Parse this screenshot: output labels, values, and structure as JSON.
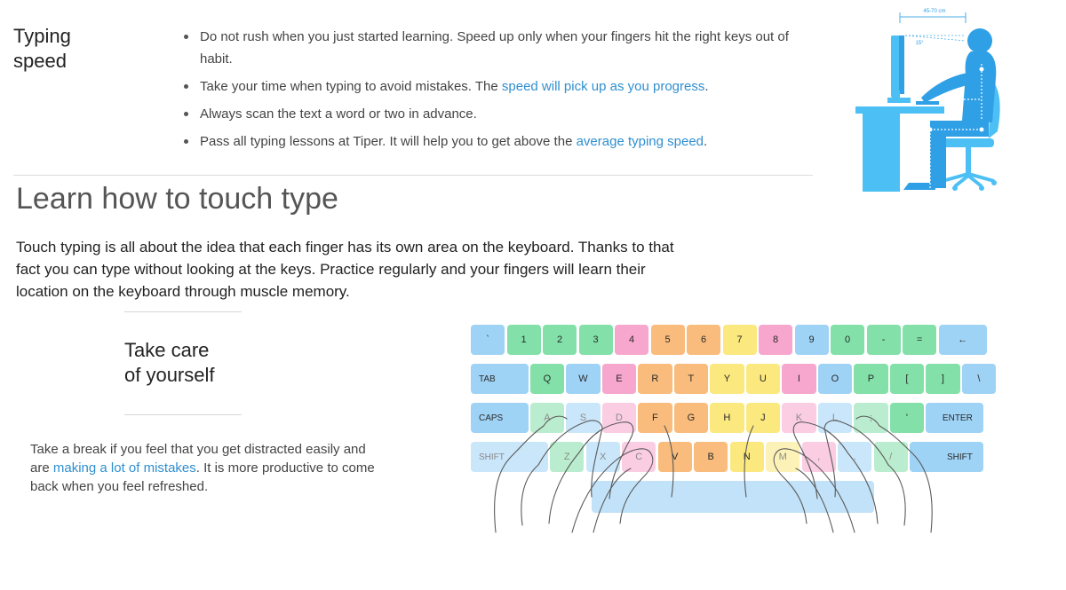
{
  "typing_speed": {
    "title": "Typing\nspeed",
    "tips": [
      {
        "text_before": "Do not rush when you just started learning. Speed up only when your fingers hit the right keys out of habit.",
        "link": "",
        "text_after": ""
      },
      {
        "text_before": "Take your time when typing to avoid mistakes. The ",
        "link": "speed will pick up as you progress",
        "text_after": "."
      },
      {
        "text_before": "Always scan the text a word or two in advance.",
        "link": "",
        "text_after": ""
      },
      {
        "text_before": "Pass all typing lessons at Tiper. It will help you to get above the ",
        "link": "average typing speed",
        "text_after": "."
      }
    ]
  },
  "posture": {
    "distance_label": "45-70 cm",
    "angle_label": "15°",
    "colors": {
      "body": "#2f9fe6",
      "furniture": "#4cc0f5",
      "lines": "#ffffff"
    }
  },
  "learn": {
    "title": "Learn how to touch type",
    "body": "Touch typing is all about the idea that each finger has its own area on the keyboard. Thanks to that fact you can type without looking at the keys. Practice regularly and your fingers will learn their location on the keyboard through muscle memory."
  },
  "care": {
    "title": "Take care\nof yourself",
    "body_before": "Take a break if you feel that you get distracted easily and are ",
    "body_link": "making a lot of mistakes",
    "body_after": ". It is more productive to come back when you feel refreshed."
  },
  "keyboard": {
    "colors": {
      "blue": "#9fd3f6",
      "green": "#82e0a8",
      "pink": "#f7a6cd",
      "orange": "#f9bc7c",
      "yellow": "#fbe87e",
      "space": "#a6d6f6"
    },
    "rows": [
      [
        {
          "label": "`",
          "color": "blue",
          "w": 1
        },
        {
          "label": "1",
          "color": "green",
          "w": 1
        },
        {
          "label": "2",
          "color": "green",
          "w": 1
        },
        {
          "label": "3",
          "color": "green",
          "w": 1
        },
        {
          "label": "4",
          "color": "pink",
          "w": 1
        },
        {
          "label": "5",
          "color": "orange",
          "w": 1
        },
        {
          "label": "6",
          "color": "orange",
          "w": 1
        },
        {
          "label": "7",
          "color": "yellow",
          "w": 1
        },
        {
          "label": "8",
          "color": "pink",
          "w": 1
        },
        {
          "label": "9",
          "color": "blue",
          "w": 1
        },
        {
          "label": "0",
          "color": "green",
          "w": 1
        },
        {
          "label": "-",
          "color": "green",
          "w": 1
        },
        {
          "label": "=",
          "color": "green",
          "w": 1
        },
        {
          "label": "←",
          "color": "blue",
          "w": 1.4
        }
      ],
      [
        {
          "label": "TAB",
          "color": "blue",
          "w": 1.65,
          "align": "left"
        },
        {
          "label": "Q",
          "color": "green",
          "w": 1
        },
        {
          "label": "W",
          "color": "blue",
          "w": 1
        },
        {
          "label": "E",
          "color": "pink",
          "w": 1
        },
        {
          "label": "R",
          "color": "orange",
          "w": 1
        },
        {
          "label": "T",
          "color": "orange",
          "w": 1
        },
        {
          "label": "Y",
          "color": "yellow",
          "w": 1
        },
        {
          "label": "U",
          "color": "yellow",
          "w": 1
        },
        {
          "label": "I",
          "color": "pink",
          "w": 1
        },
        {
          "label": "O",
          "color": "blue",
          "w": 1
        },
        {
          "label": "P",
          "color": "green",
          "w": 1
        },
        {
          "label": "[",
          "color": "green",
          "w": 1
        },
        {
          "label": "]",
          "color": "green",
          "w": 1
        },
        {
          "label": "\\",
          "color": "blue",
          "w": 1
        }
      ],
      [
        {
          "label": "CAPS",
          "color": "blue",
          "w": 1.65,
          "align": "left"
        },
        {
          "label": "A",
          "color": "green",
          "w": 1,
          "faded": true
        },
        {
          "label": "S",
          "color": "blue",
          "w": 1,
          "faded": true
        },
        {
          "label": "D",
          "color": "pink",
          "w": 1,
          "faded": true
        },
        {
          "label": "F",
          "color": "orange",
          "w": 1
        },
        {
          "label": "G",
          "color": "orange",
          "w": 1
        },
        {
          "label": "H",
          "color": "yellow",
          "w": 1
        },
        {
          "label": "J",
          "color": "yellow",
          "w": 1
        },
        {
          "label": "K",
          "color": "pink",
          "w": 1,
          "faded": true
        },
        {
          "label": "L",
          "color": "blue",
          "w": 1,
          "faded": true
        },
        {
          "label": ";",
          "color": "green",
          "w": 1,
          "faded": true
        },
        {
          "label": "'",
          "color": "green",
          "w": 1
        },
        {
          "label": "ENTER",
          "color": "blue",
          "w": 1.65,
          "align": "right"
        }
      ],
      [
        {
          "label": "SHIFT",
          "color": "blue",
          "w": 2.2,
          "align": "left",
          "faded": true
        },
        {
          "label": "Z",
          "color": "green",
          "w": 1,
          "faded": true
        },
        {
          "label": "X",
          "color": "blue",
          "w": 1,
          "faded": true
        },
        {
          "label": "C",
          "color": "pink",
          "w": 1,
          "faded": true
        },
        {
          "label": "V",
          "color": "orange",
          "w": 1
        },
        {
          "label": "B",
          "color": "orange",
          "w": 1
        },
        {
          "label": "N",
          "color": "yellow",
          "w": 1
        },
        {
          "label": "M",
          "color": "yellow",
          "w": 1,
          "faded": true
        },
        {
          "label": ",",
          "color": "pink",
          "w": 1,
          "faded": true
        },
        {
          "label": ".",
          "color": "blue",
          "w": 1,
          "faded": true
        },
        {
          "label": "/",
          "color": "green",
          "w": 1,
          "faded": true
        },
        {
          "label": "SHIFT",
          "color": "blue",
          "w": 2.1,
          "align": "right"
        }
      ]
    ],
    "space_label": ""
  }
}
